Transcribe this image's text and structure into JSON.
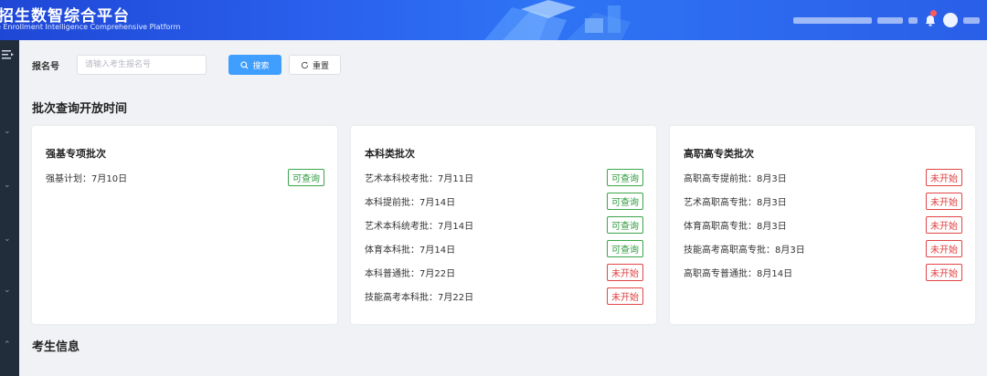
{
  "header": {
    "title": "招生数智综合平台",
    "subtitle": "e Enrollment Intelligence Comprehensive Platform"
  },
  "search": {
    "label": "报名号",
    "placeholder": "请输入考生报名号",
    "value": "",
    "search_button": "搜索",
    "reset_button": "重置"
  },
  "sections": {
    "batch_title": "批次查询开放时间",
    "student_title": "考生信息"
  },
  "colors": {
    "header_blue": "#2a62ee",
    "primary": "#409eff",
    "available_green": "#2e9a3e",
    "not_started_red": "#e04040",
    "sidebar_dark": "#222d3c"
  },
  "cards": [
    {
      "title": "强基专项批次",
      "rows": [
        {
          "label": "强基计划：7月10日",
          "status": "可查询",
          "state": "available"
        }
      ]
    },
    {
      "title": "本科类批次",
      "rows": [
        {
          "label": "艺术本科校考批：7月11日",
          "status": "可查询",
          "state": "available"
        },
        {
          "label": "本科提前批：7月14日",
          "status": "可查询",
          "state": "available"
        },
        {
          "label": "艺术本科统考批：7月14日",
          "status": "可查询",
          "state": "available"
        },
        {
          "label": "体育本科批：7月14日",
          "status": "可查询",
          "state": "available"
        },
        {
          "label": "本科普通批：7月22日",
          "status": "未开始",
          "state": "not_started"
        },
        {
          "label": "技能高考本科批：7月22日",
          "status": "未开始",
          "state": "not_started"
        }
      ]
    },
    {
      "title": "高职高专类批次",
      "rows": [
        {
          "label": "高职高专提前批：8月3日",
          "status": "未开始",
          "state": "not_started"
        },
        {
          "label": "艺术高职高专批：8月3日",
          "status": "未开始",
          "state": "not_started"
        },
        {
          "label": "体育高职高专批：8月3日",
          "status": "未开始",
          "state": "not_started"
        },
        {
          "label": "技能高考高职高专批：8月3日",
          "status": "未开始",
          "state": "not_started"
        },
        {
          "label": "高职高专普通批：8月14日",
          "status": "未开始",
          "state": "not_started"
        }
      ]
    }
  ]
}
